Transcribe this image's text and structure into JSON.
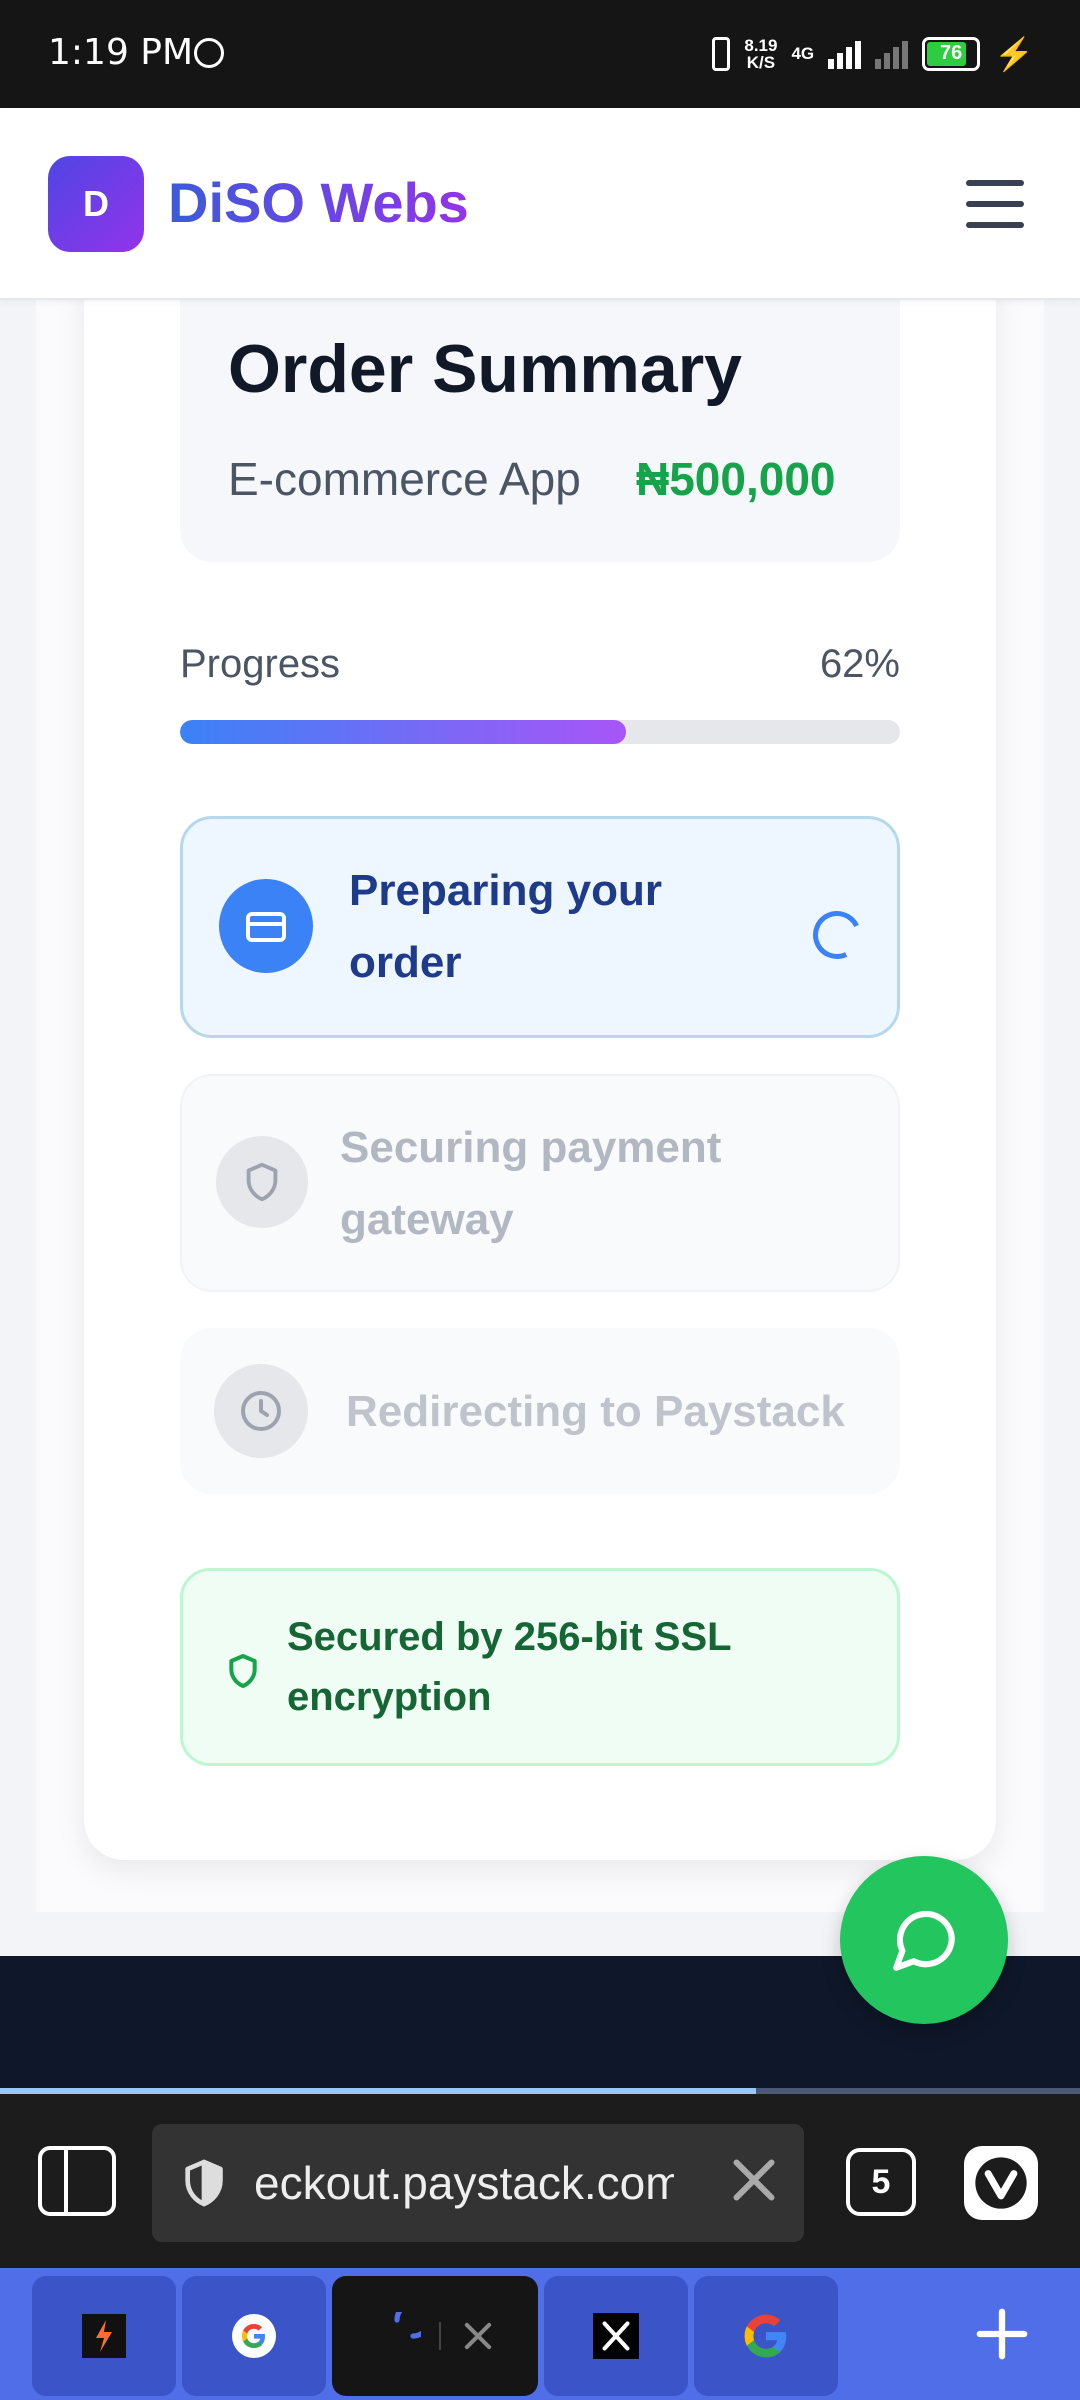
{
  "status_bar": {
    "time": "1:19 PM",
    "speed_value": "8.19",
    "speed_unit": "K/S",
    "network": "4G",
    "battery": "76"
  },
  "header": {
    "logo_letter": "D",
    "brand": "DiSO Webs"
  },
  "order": {
    "title": "Order Summary",
    "item": "E-commerce App",
    "price": "₦500,000"
  },
  "progress": {
    "label": "Progress",
    "value_text": "62%",
    "value": 0.62
  },
  "steps": [
    {
      "label": "Preparing your order",
      "state": "active",
      "icon": "card-icon"
    },
    {
      "label": "Securing payment gateway",
      "state": "pending",
      "icon": "shield-icon"
    },
    {
      "label": "Redirecting to Paystack",
      "state": "pending",
      "icon": "clock-icon"
    }
  ],
  "security": {
    "text": "Secured by 256-bit SSL encryption"
  },
  "browser": {
    "url": "eckout.paystack.com",
    "tab_count": "5",
    "page_load_progress": 0.7
  },
  "colors": {
    "accent_blue": "#3b82f6",
    "accent_purple": "#a855f7",
    "success_green": "#16a34a",
    "fab_green": "#22c55e",
    "tabstrip_blue": "#4f6ee8"
  }
}
